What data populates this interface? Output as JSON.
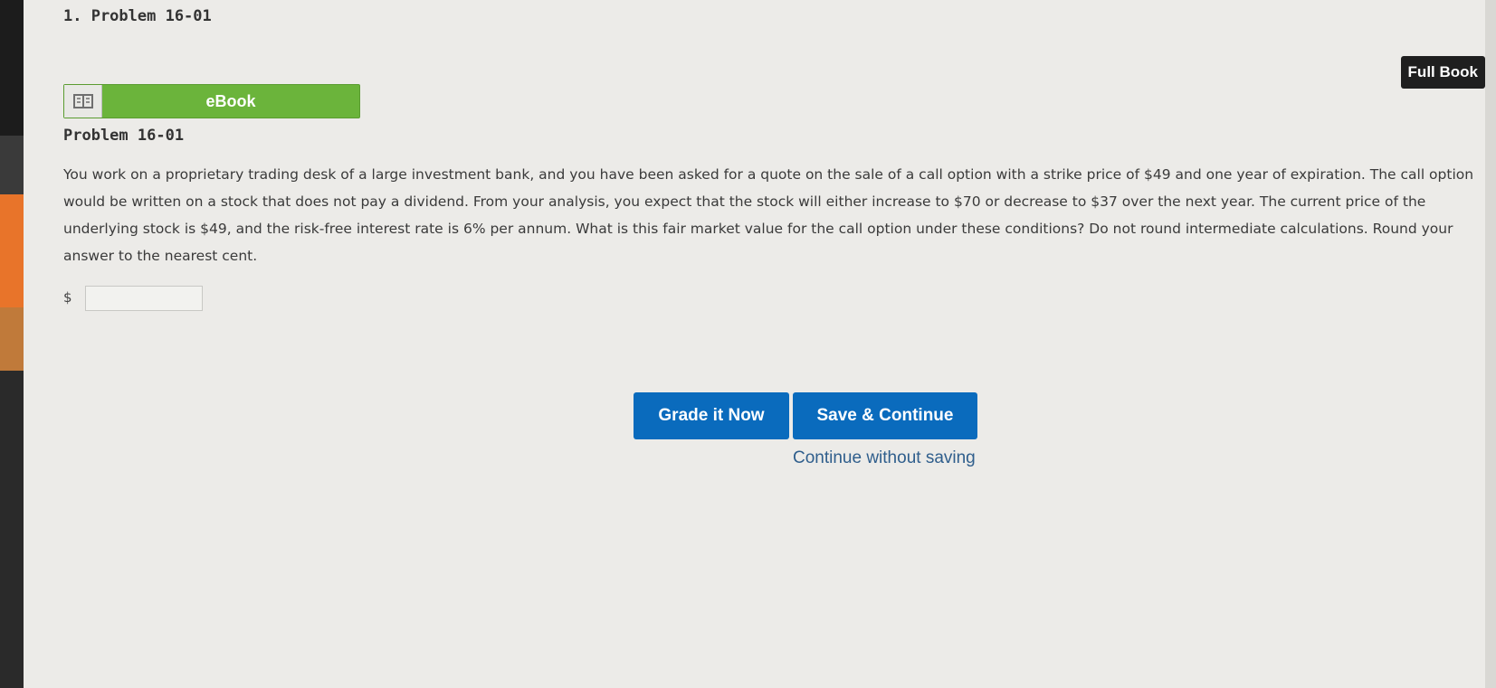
{
  "header": {
    "title": "1. Problem 16-01",
    "full_book_label": "Full Book"
  },
  "ebook": {
    "label": "eBook"
  },
  "problem": {
    "title": "Problem 16-01",
    "text": "You work on a proprietary trading desk of a large investment bank, and you have been asked for a quote on the sale of a call option with a strike price of $49 and one year of expiration. The call option would be written on a stock that does not pay a dividend. From your analysis, you expect that the stock will either increase to $70 or decrease to $37 over the next year. The current price of the underlying stock is $49, and the risk-free interest rate is 6% per annum. What is this fair market value for the call option under these conditions? Do not round intermediate calculations. Round your answer to the nearest cent.",
    "currency_symbol": "$",
    "answer_value": "",
    "answer_placeholder": ""
  },
  "actions": {
    "grade_label": "Grade it Now",
    "save_label": "Save & Continue",
    "continue_label": "Continue without saving"
  },
  "colors": {
    "primary_button": "#0a6bbd",
    "ebook_green": "#6bb43b",
    "link": "#2f5e8c"
  },
  "icons": {
    "ebook": "book-icon"
  }
}
